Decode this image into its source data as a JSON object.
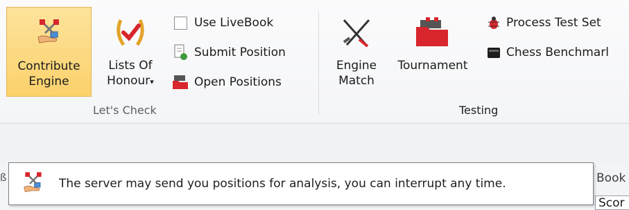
{
  "ribbon": {
    "lets_check": {
      "contribute_engine": {
        "line1": "Contribute",
        "line2": "Engine"
      },
      "lists_of_honour": {
        "line1": "Lists Of",
        "line2": "Honour"
      },
      "use_livebook": "Use LiveBook",
      "submit_position": "Submit Position",
      "open_positions": "Open Positions",
      "group_label": "Let's Check"
    },
    "testing": {
      "engine_match": {
        "line1": "Engine",
        "line2": "Match"
      },
      "tournament": "Tournament",
      "process_test_set": "Process Test Set",
      "chess_benchmark": "Chess Benchmarl",
      "group_label": "Testing"
    }
  },
  "tooltip": {
    "text": "The server may send you positions for analysis, you can interrupt any time."
  },
  "background": {
    "book_tab": "Book",
    "score_header": "Scor"
  },
  "colors": {
    "active_button": "#fbd16b",
    "accent_red": "#d8262c"
  },
  "icons": {
    "contribute": "hand-with-computer-icon",
    "honour": "laurel-checkmark-icon",
    "livebook": "checkbox-icon",
    "submit": "document-upload-icon",
    "open": "red-folder-stack-icon",
    "engine_match": "crossed-swords-icon",
    "tournament": "red-folder-icon",
    "process_test": "bug-icon",
    "benchmark": "black-box-icon"
  }
}
